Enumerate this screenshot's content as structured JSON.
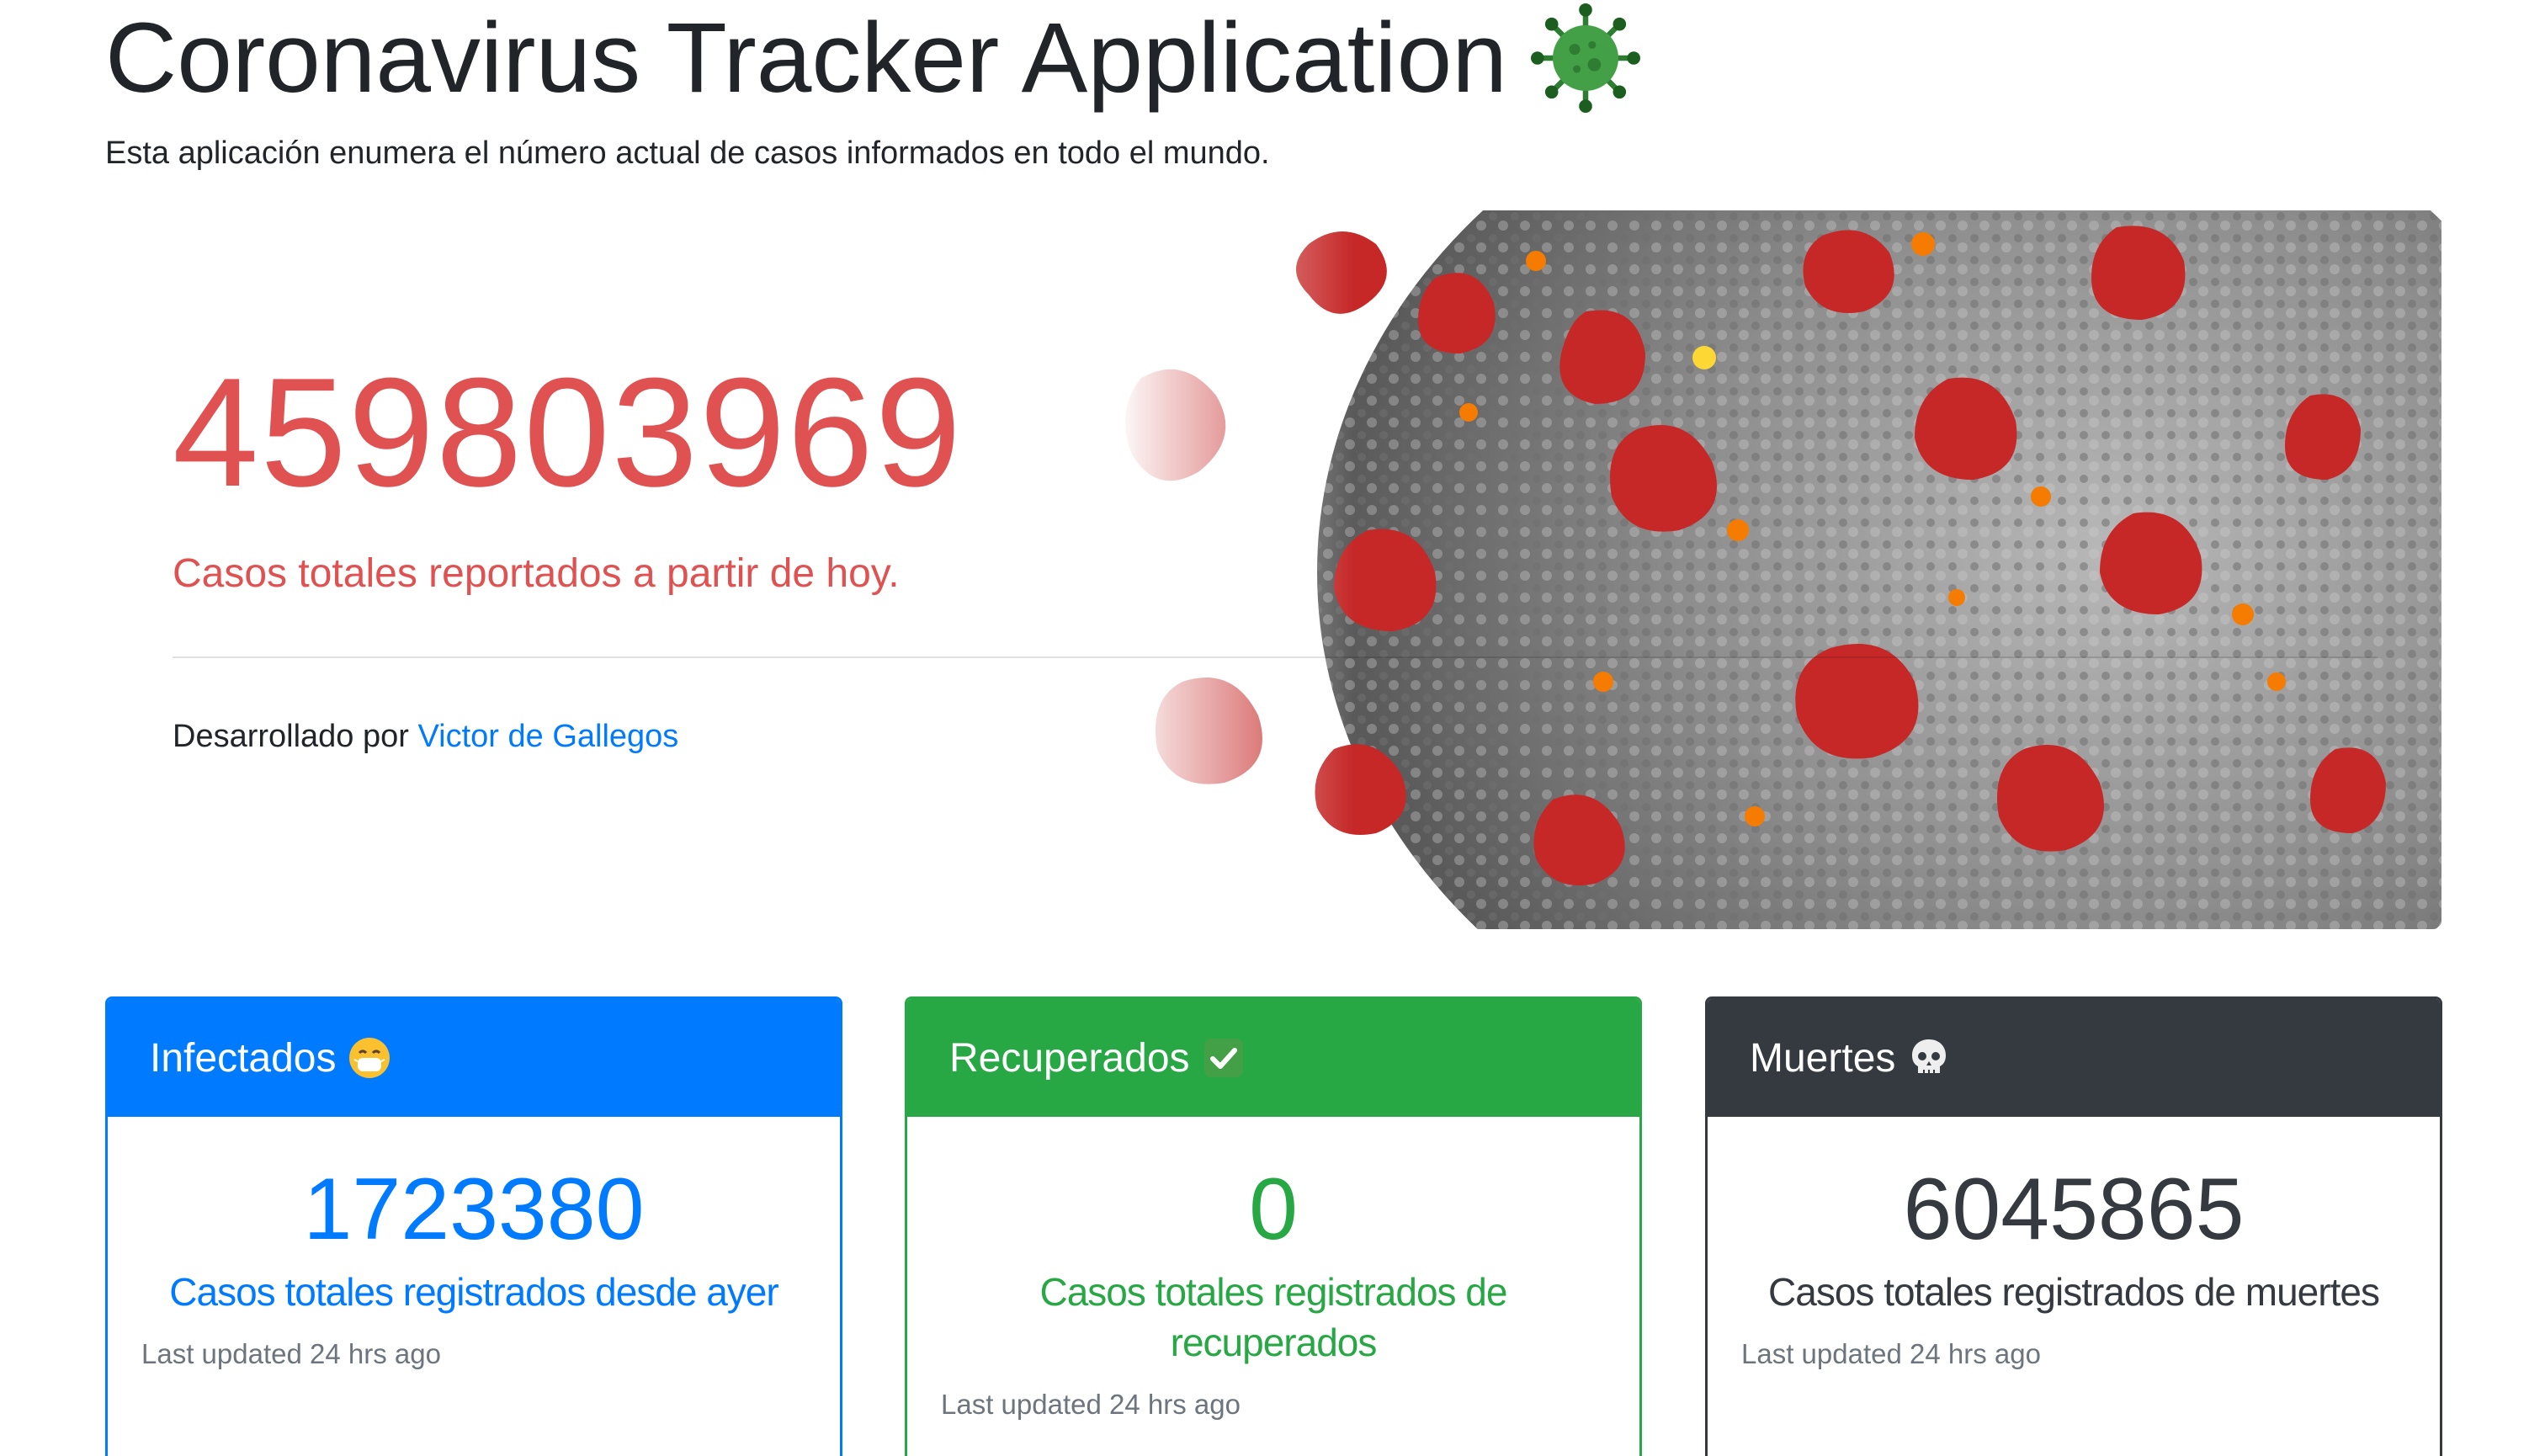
{
  "header": {
    "title": "Coronavirus Tracker Application",
    "title_icon": "virus-icon",
    "subtitle": "Esta aplicación enumera el número actual de casos informados en todo el mundo."
  },
  "jumbotron": {
    "total_cases": "459803969",
    "lead": "Casos totales reportados a partir de hoy.",
    "credits_prefix": "Desarrollado por",
    "credits_link": "Victor de Gallegos",
    "hero_image": "coronavirus-illustration",
    "colors": {
      "accent": "#e05252",
      "link": "#007bff"
    }
  },
  "cards": [
    {
      "header": "Infectados",
      "icon": "mask-face-icon",
      "value": "1723380",
      "text": "Casos totales registrados desde ayer",
      "footer": "Last updated 24 hrs ago",
      "color": "#007bff"
    },
    {
      "header": "Recuperados",
      "icon": "check-mark-icon",
      "value": "0",
      "text": "Casos totales registrados de recuperados",
      "footer": "Last updated 24 hrs ago",
      "color": "#28a745"
    },
    {
      "header": "Muertes",
      "icon": "skull-icon",
      "value": "6045865",
      "text": "Casos totales registrados de muertes",
      "footer": "Last updated 24 hrs ago",
      "color": "#343a40"
    }
  ]
}
